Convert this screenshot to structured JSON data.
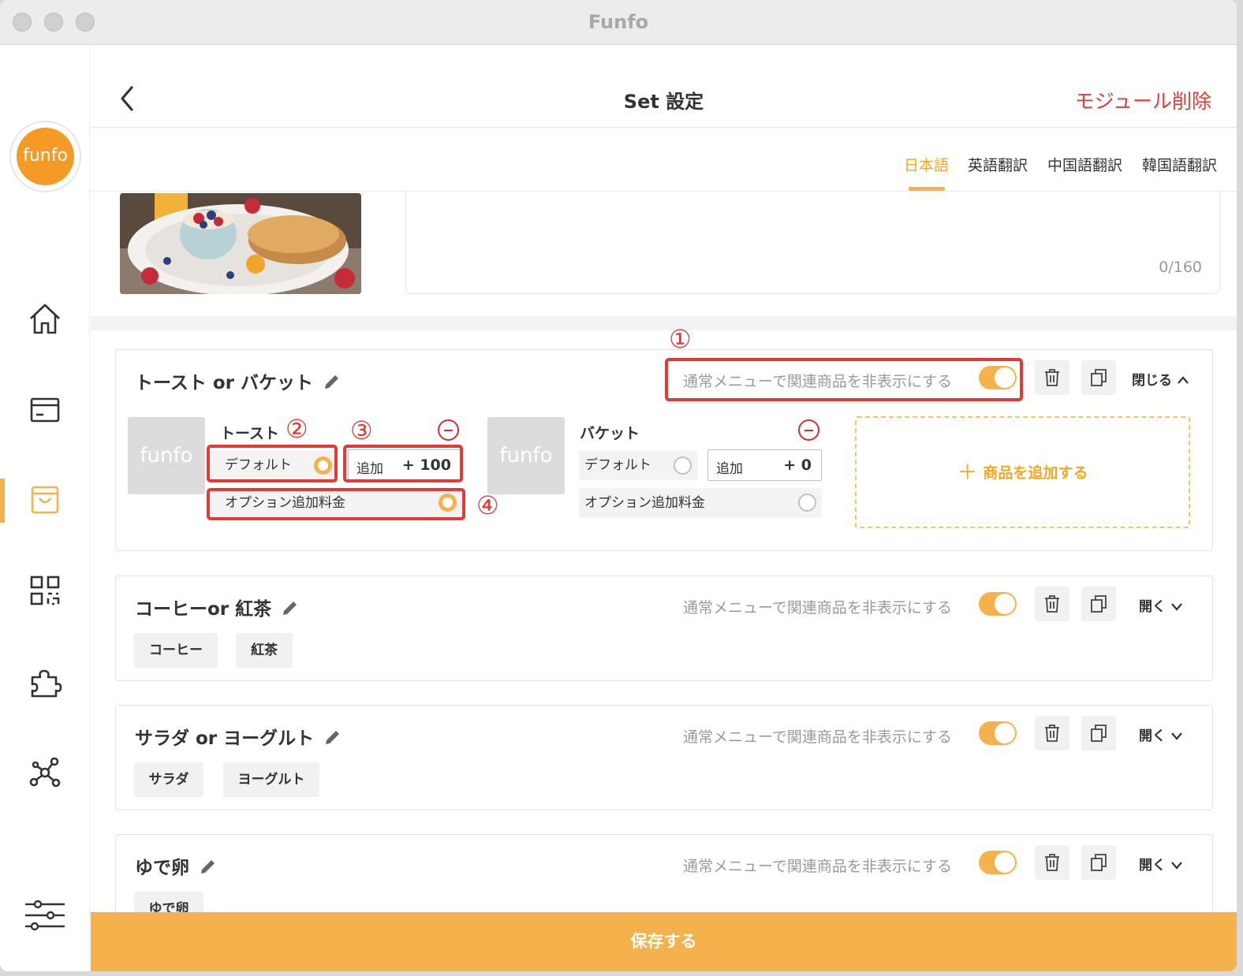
{
  "window": {
    "title": "Funfo"
  },
  "logo": {
    "text": "funfo"
  },
  "header": {
    "title": "Set 設定",
    "delete_label": "モジュール削除"
  },
  "tabs": [
    {
      "label": "日本語",
      "active": true
    },
    {
      "label": "英語翻訳"
    },
    {
      "label": "中国語翻訳"
    },
    {
      "label": "韓国語翻訳"
    }
  ],
  "description": {
    "counter": "0/160"
  },
  "sidebar": {
    "items": [
      "home-icon",
      "card-icon",
      "store-icon",
      "qr-code-icon",
      "puzzle-icon",
      "network-icon",
      "settings-sliders-icon"
    ],
    "active": "store-icon"
  },
  "common": {
    "hide_label": "通常メニューで関連商品を非表示にする",
    "close_label": "閉じる",
    "open_label": "開く",
    "default_label": "デフォルト",
    "add_label": "追加",
    "option_label": "オプション追加料金",
    "thumb_text": "funfo",
    "add_product_label": "商品を追加する",
    "save_label": "保存する"
  },
  "groups": [
    {
      "title": "トースト or バケット",
      "expanded": true,
      "products": [
        {
          "name": "トースト",
          "default_selected": true,
          "price": "+ 100",
          "option_selected": true
        },
        {
          "name": "バケット",
          "default_selected": false,
          "price": "+ 0",
          "option_selected": false
        }
      ]
    },
    {
      "title": "コーヒーor 紅茶",
      "expanded": false,
      "items": [
        "コーヒー",
        "紅茶"
      ]
    },
    {
      "title": "サラダ or ヨーグルト",
      "expanded": false,
      "items": [
        "サラダ",
        "ヨーグルト"
      ]
    },
    {
      "title": "ゆで卵",
      "expanded": false,
      "items": [
        "ゆで卵"
      ]
    }
  ],
  "annotations": [
    "①",
    "②",
    "③",
    "④"
  ],
  "colors": {
    "accent": "#f5b14c",
    "accent_text": "#f5a623",
    "danger": "#e53935"
  }
}
